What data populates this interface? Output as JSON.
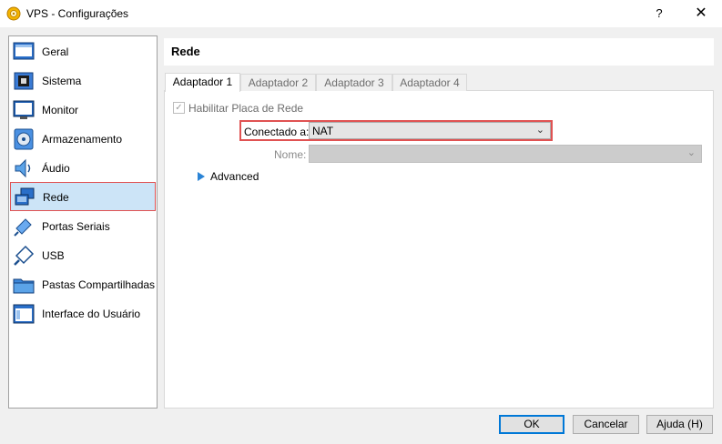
{
  "window": {
    "title": "VPS - Configurações",
    "help_label": "?",
    "close_label": "✕"
  },
  "sidebar": {
    "items": [
      {
        "label": "Geral",
        "icon": "general-icon"
      },
      {
        "label": "Sistema",
        "icon": "system-icon"
      },
      {
        "label": "Monitor",
        "icon": "monitor-icon"
      },
      {
        "label": "Armazenamento",
        "icon": "storage-icon"
      },
      {
        "label": "Áudio",
        "icon": "audio-icon"
      },
      {
        "label": "Rede",
        "icon": "network-icon",
        "selected": true
      },
      {
        "label": "Portas Seriais",
        "icon": "serial-ports-icon"
      },
      {
        "label": "USB",
        "icon": "usb-icon"
      },
      {
        "label": "Pastas Compartilhadas",
        "icon": "shared-folders-icon"
      },
      {
        "label": "Interface do Usuário",
        "icon": "user-interface-icon"
      }
    ]
  },
  "header": {
    "title": "Rede"
  },
  "tabs": [
    {
      "label": "Adaptador 1",
      "active": true
    },
    {
      "label": "Adaptador 2"
    },
    {
      "label": "Adaptador 3"
    },
    {
      "label": "Adaptador 4"
    }
  ],
  "adapter": {
    "enable_label": "Habilitar Placa de Rede",
    "enable_checked": true,
    "connected_label": "Conectado a:",
    "connected_value": "NAT",
    "name_label": "Nome:",
    "name_value": "",
    "advanced_label": "Advanced"
  },
  "buttons": {
    "ok": "OK",
    "cancel": "Cancelar",
    "help": "Ajuda (H)"
  },
  "colors": {
    "highlight": "#e05252",
    "selection": "#cce4f7",
    "accent": "#0078d7"
  }
}
